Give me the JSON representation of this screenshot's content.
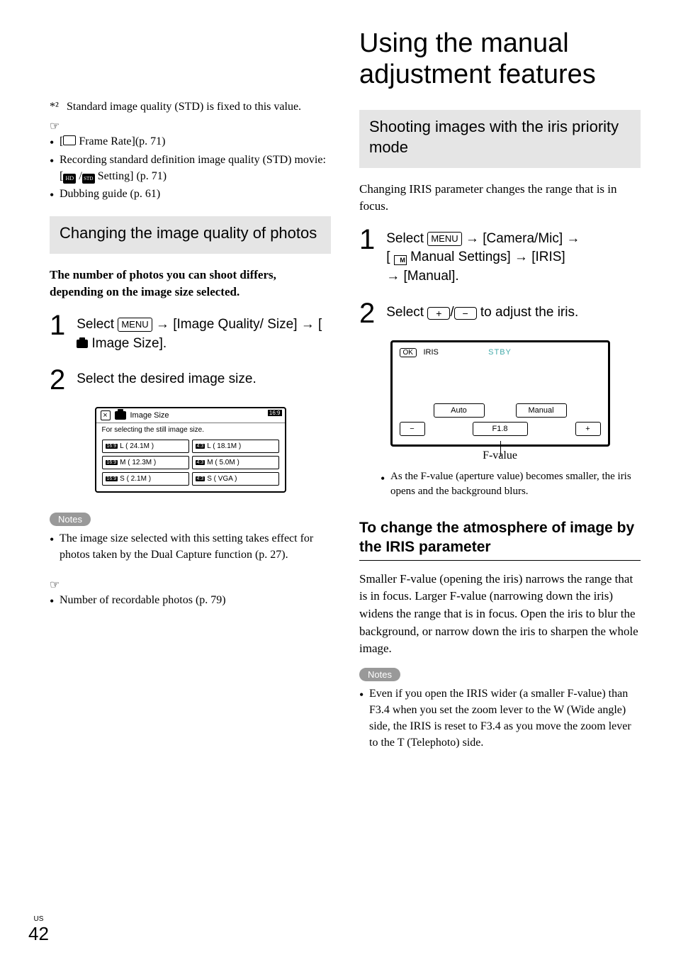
{
  "left": {
    "footnote_marker": "*²",
    "footnote_text": "Standard image quality (STD) is fixed to this value.",
    "refs": [
      "[ 🎞 Frame Rate](p. 71)",
      "Recording standard definition image quality (STD) movie: [ HD / STD Setting] (p. 71)",
      "Dubbing guide (p. 61)"
    ],
    "section_heading": "Changing the image quality of photos",
    "intro_bold": "The number of photos you can shoot differs, depending on the image size selected.",
    "step1_a": "Select ",
    "menu_label": "MENU",
    "step1_b": " → [Image Quality/Size] → [ ",
    "step1_c": " Image Size].",
    "step2": "Select the desired image size.",
    "dialog": {
      "title": "Image Size",
      "ratio": "16:9",
      "desc": "For selecting the still image size.",
      "opts": [
        {
          "r": "16:9",
          "t": "L ( 24.1M )"
        },
        {
          "r": "4:3",
          "t": "L ( 18.1M )"
        },
        {
          "r": "16:9",
          "t": "M ( 12.3M )"
        },
        {
          "r": "4:3",
          "t": "M ( 5.0M )"
        },
        {
          "r": "16:9",
          "t": "S ( 2.1M )"
        },
        {
          "r": "4:3",
          "t": "S ( VGA )"
        }
      ]
    },
    "notes_label": "Notes",
    "note1": "The image size selected with this setting takes effect for photos taken by the Dual Capture function (p. 27).",
    "ref2": "Number of recordable photos (p. 79)"
  },
  "right": {
    "main_heading": "Using the manual adjustment features",
    "section_heading": "Shooting images with the iris priority mode",
    "intro": "Changing IRIS parameter changes the range that is in focus.",
    "step1_a": "Select ",
    "step1_b": " → [Camera/Mic] → [ ",
    "step1_c": " Manual Settings] → [IRIS] → [Manual].",
    "step2_a": "Select ",
    "step2_b": " to adjust the iris.",
    "iris": {
      "ok": "OK",
      "iris": "IRIS",
      "stby": "STBY",
      "auto": "Auto",
      "manual": "Manual",
      "fval": "F1.8",
      "caption": "F-value"
    },
    "sub_bullet": "As the F-value (aperture value) becomes smaller, the iris opens and the background blurs.",
    "sub_heading": "To change the atmosphere of image by the IRIS parameter",
    "para": "Smaller F-value (opening the iris) narrows the range that is in focus. Larger F-value (narrowing down the iris) widens the range that is in focus. Open the iris to blur the background, or narrow down the iris to sharpen the whole image.",
    "notes_label": "Notes",
    "note1": "Even if you open the IRIS wider (a smaller F-value) than F3.4 when you set the zoom lever to the W (Wide angle) side, the IRIS is reset to F3.4 as you move the zoom lever to the T (Telephoto) side."
  },
  "page": {
    "region": "US",
    "number": "42"
  }
}
